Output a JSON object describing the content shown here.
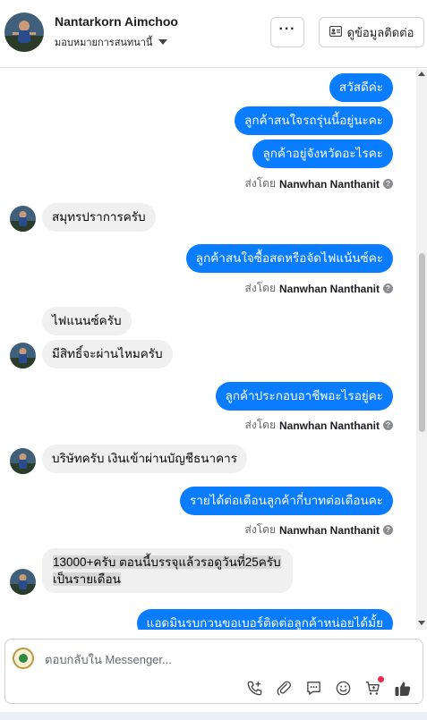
{
  "header": {
    "name": "Nantarkorn Aimchoo",
    "assign_label": "มอบหมายการสนทนานี้",
    "more_label": "···",
    "contact_label": "ดูข้อมูลติดต่อ"
  },
  "messages": {
    "m1": "สวัสดีค่ะ",
    "m2": "ลูกค้าสนใจรถรุ่นนี้อยู่นะคะ",
    "m3": "ลูกค้าอยู่จังหวัดอะไรคะ",
    "m4": "สมุทรปราการครับ",
    "m5": "ลูกค้าสนใจซื้อสดหรือจัดไฟแน้นซ์คะ",
    "m6": "ไฟแนนซ์ครับ",
    "m7": "มีสิทธิ์จะผ่านไหมครับ",
    "m8": "ลูกค้าประกอบอาชีพอะไรอยู่คะ",
    "m9": "บริษัทครับ  เงินเข้าผ่านบัญชีธนาคาร",
    "m10": "รายได้ต่อเดือนลูกค้ากี่บาทต่อเดือนคะ",
    "m11_line1": "13000+ครับ ตอนนี้บรรจุแล้วรอดูวันที่25ครับ",
    "m11_line2": "เป็นรายเดือน",
    "m12": "แอดมินรบกวนขอเบอร์ติดต่อลูกค้าหน่อยได้มั้ย"
  },
  "sent_by": {
    "prefix": "ส่งโดย",
    "agent": "Nanwhan Nanthanit"
  },
  "composer": {
    "placeholder": "ตอบกลับใน Messenger..."
  },
  "colors": {
    "outgoing_bubble": "#0a7cff",
    "incoming_bubble": "#f0f0f0",
    "notification_dot": "#f02849",
    "brand_blue": "#1877f2"
  },
  "icons": [
    "phone-add-icon",
    "attachment-icon",
    "saved-reply-icon",
    "emoji-icon",
    "cart-icon",
    "thumbs-up-icon",
    "info-icon",
    "contact-card-icon"
  ]
}
